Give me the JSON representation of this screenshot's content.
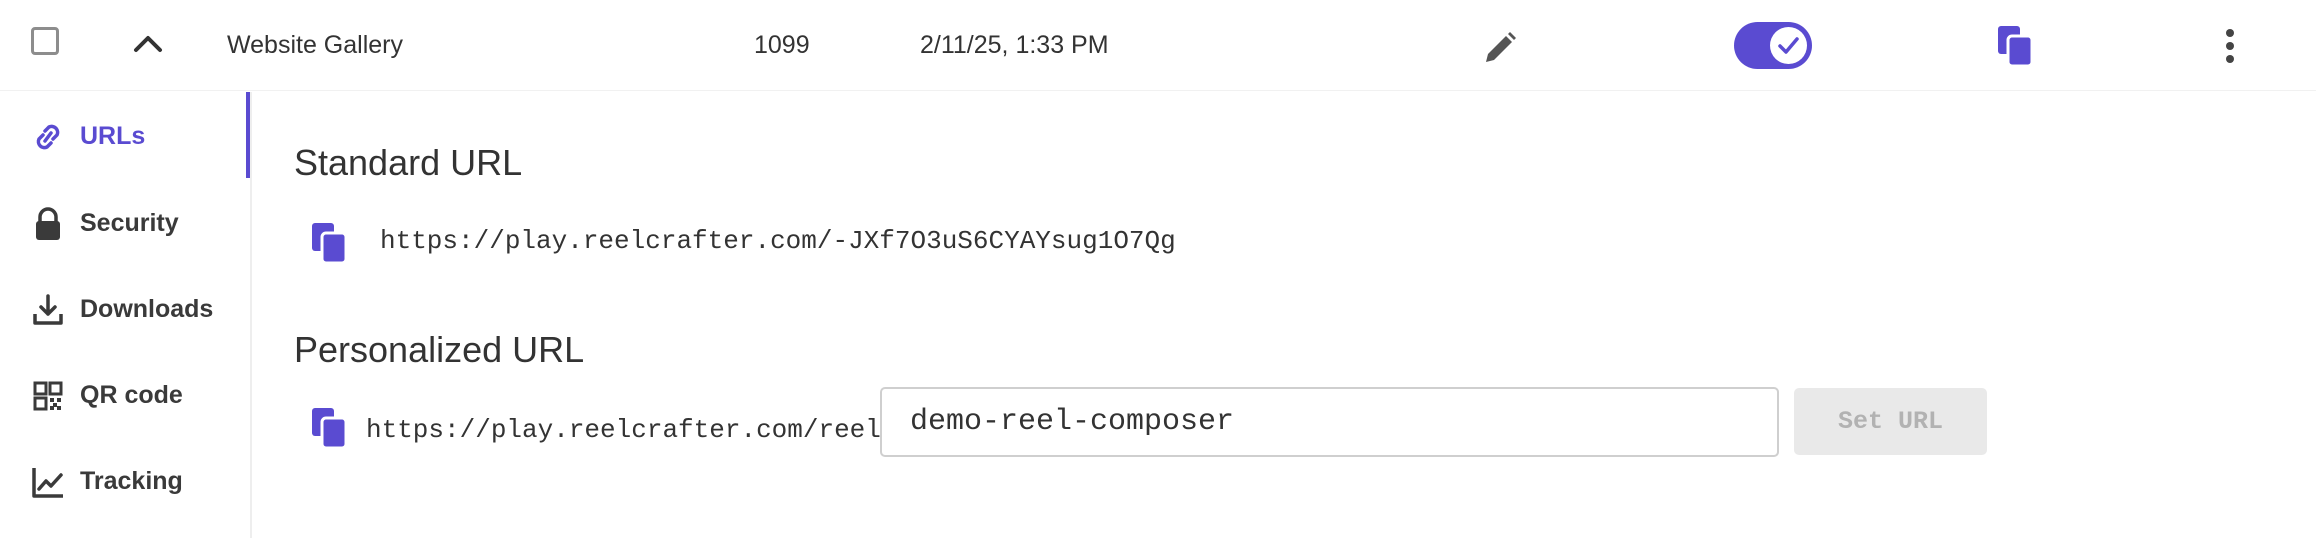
{
  "row": {
    "name": "Website Gallery",
    "count": "1099",
    "date": "2/11/25, 1:33 PM",
    "toggle_on": true,
    "icons": {
      "checkbox": "checkbox-empty",
      "collapse": "chevron-up-icon",
      "edit": "pencil-icon",
      "toggle": "toggle-check-icon",
      "copy": "copy-icon",
      "more": "kebab-menu-icon"
    }
  },
  "sidebar": {
    "items": [
      {
        "label": "URLs",
        "icon": "link-icon",
        "active": true
      },
      {
        "label": "Security",
        "icon": "lock-icon",
        "active": false
      },
      {
        "label": "Downloads",
        "icon": "download-icon",
        "active": false
      },
      {
        "label": "QR code",
        "icon": "qr-code-icon",
        "active": false
      },
      {
        "label": "Tracking",
        "icon": "line-chart-icon",
        "active": false
      }
    ]
  },
  "main": {
    "standard": {
      "heading": "Standard URL",
      "url": "https://play.reelcrafter.com/-JXf7O3uS6CYAYsug1O7Qg"
    },
    "personalized": {
      "heading": "Personalized URL",
      "prefix": "https://play.reelcrafter.com/reel/",
      "value": "demo-reel-composer",
      "button_label": "Set URL"
    }
  },
  "colors": {
    "accent": "#5a4bd1",
    "text": "#333333",
    "disabled_button_bg": "#e9e9e9",
    "disabled_button_text": "#b2b2b2"
  }
}
